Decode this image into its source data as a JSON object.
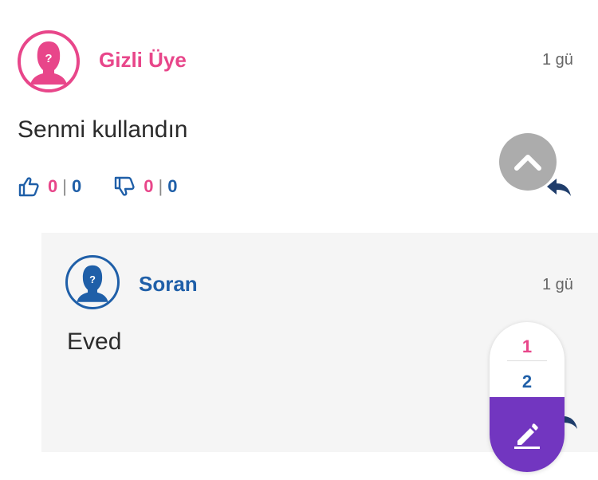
{
  "comment": {
    "author": "Gizli Üye",
    "time": "1 gü",
    "text": "Senmi kullandın",
    "likes": {
      "up_a": "0",
      "up_b": "0",
      "down_a": "0",
      "down_b": "0"
    },
    "avatar_icon": "anonymous-user-icon",
    "accent": "#e8468a"
  },
  "reply": {
    "author": "Soran",
    "time": "1 gü",
    "text": "Eved",
    "avatar_icon": "anonymous-user-icon",
    "accent": "#1f5fa8"
  },
  "pagination": {
    "page_1": "1",
    "page_2": "2"
  },
  "icons": {
    "like": "thumbs-up-icon",
    "dislike": "thumbs-down-icon",
    "reply": "reply-arrow-icon",
    "scroll_up": "chevron-up-icon",
    "edit": "pencil-icon"
  },
  "colors": {
    "edit_button": "#7236c0",
    "scroll_up": "#9e9e9e"
  }
}
